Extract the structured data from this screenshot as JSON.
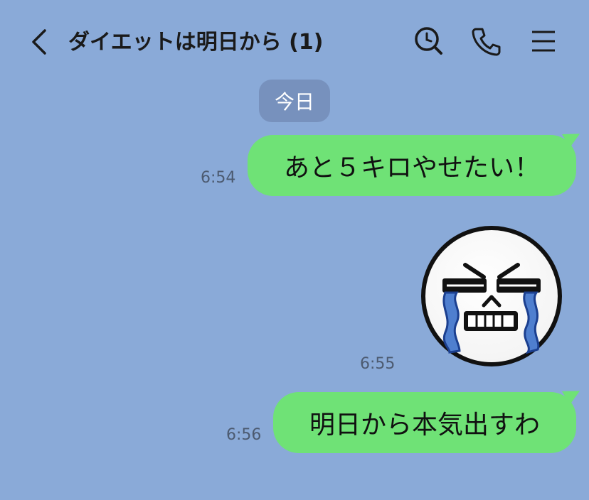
{
  "header": {
    "title": "ダイエットは明日から (1)",
    "icons": [
      "back-chevron-icon",
      "search-icon",
      "phone-icon",
      "menu-icon"
    ]
  },
  "date_divider": "今日",
  "messages": [
    {
      "text": "あと５キロやせたい！",
      "time": "6:54"
    },
    {
      "type": "sticker",
      "sticker": "crying-face-sticker",
      "time": "6:55"
    },
    {
      "text": "明日から本気出すわ",
      "time": "6:56"
    }
  ],
  "colors": {
    "background": "#8aaad8",
    "bubble": "#6fe276",
    "date_pill": "#7791bd"
  }
}
